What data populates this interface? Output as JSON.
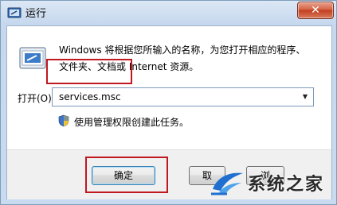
{
  "window": {
    "title": "运行",
    "close_symbol": "✕"
  },
  "description": {
    "line1": "Windows 将根据您所输入的名称，为您打开相应的程序、",
    "line2": "文件夹、文档或 Internet 资源。"
  },
  "open_field": {
    "label": "打开(O):",
    "value": "services.msc",
    "dropdown_symbol": "▼"
  },
  "admin_note": "使用管理权限创建此任务。",
  "buttons": {
    "ok": "确定",
    "cancel": "取",
    "browse": "浏"
  },
  "watermark": {
    "text": "系统之家"
  },
  "colors": {
    "highlight": "#c0181f",
    "close_button": "#c2401f",
    "watermark_logo": "#1e6fd0"
  }
}
